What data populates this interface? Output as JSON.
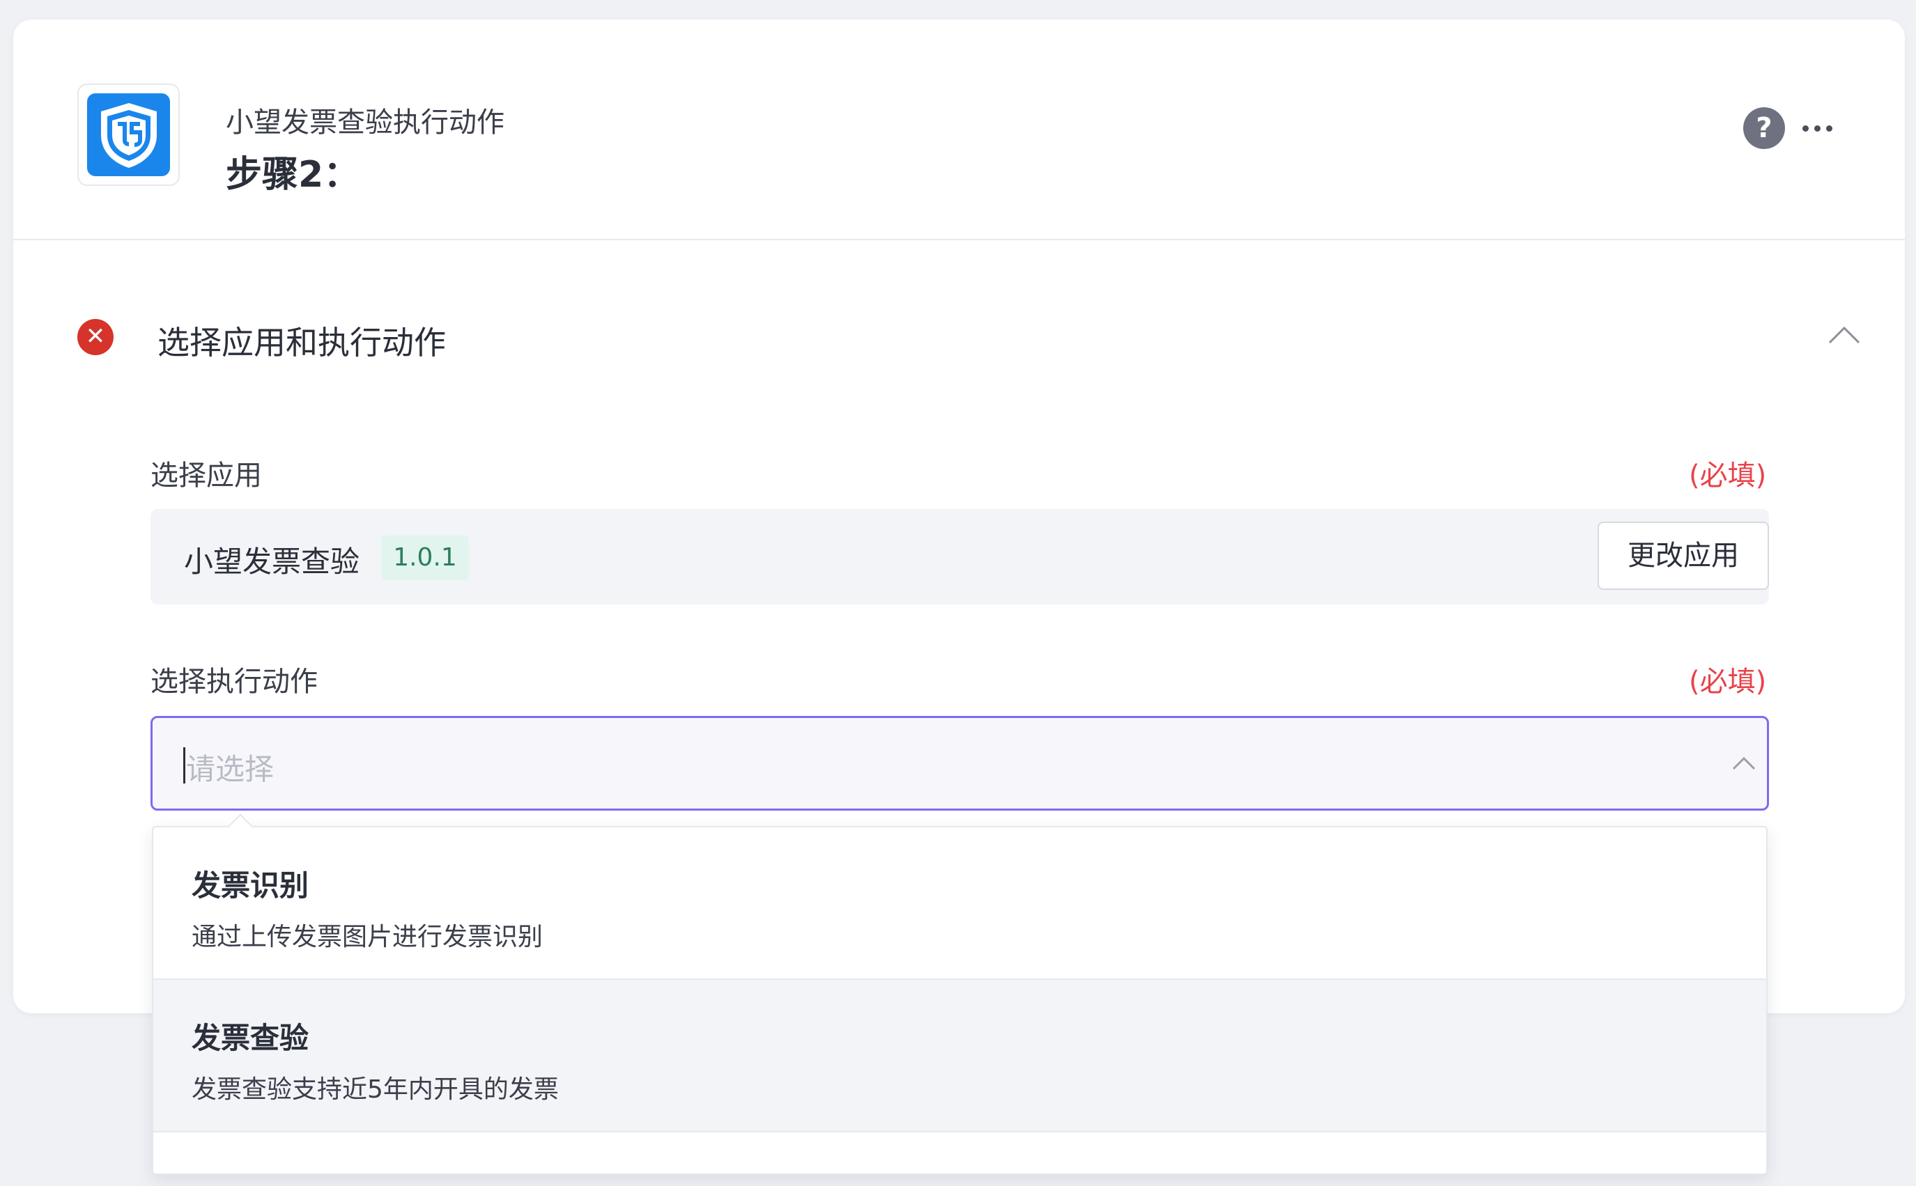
{
  "header": {
    "app_subtitle": "小望发票查验执行动作",
    "step_title": "步骤2：",
    "help_icon_glyph": "?"
  },
  "section": {
    "title": "选择应用和执行动作",
    "status": "error"
  },
  "select_app": {
    "label": "选择应用",
    "required_text": "(必填)",
    "app_name": "小望发票查验",
    "version": "1.0.1",
    "change_button": "更改应用"
  },
  "select_action": {
    "label": "选择执行动作",
    "required_text": "(必填)",
    "placeholder": "请选择",
    "value": ""
  },
  "dropdown": {
    "options": [
      {
        "title": "发票识别",
        "description": "通过上传发票图片进行发票识别"
      },
      {
        "title": "发票查验",
        "description": "发票查验支持近5年内开具的发票"
      }
    ],
    "highlighted_index": 1
  },
  "colors": {
    "accent": "#7b6cf0",
    "required": "#e8434a",
    "error": "#d6332a",
    "logo_blue": "#1a86ec",
    "badge_bg": "#e1f5ee",
    "badge_text": "#2e7d5b"
  }
}
